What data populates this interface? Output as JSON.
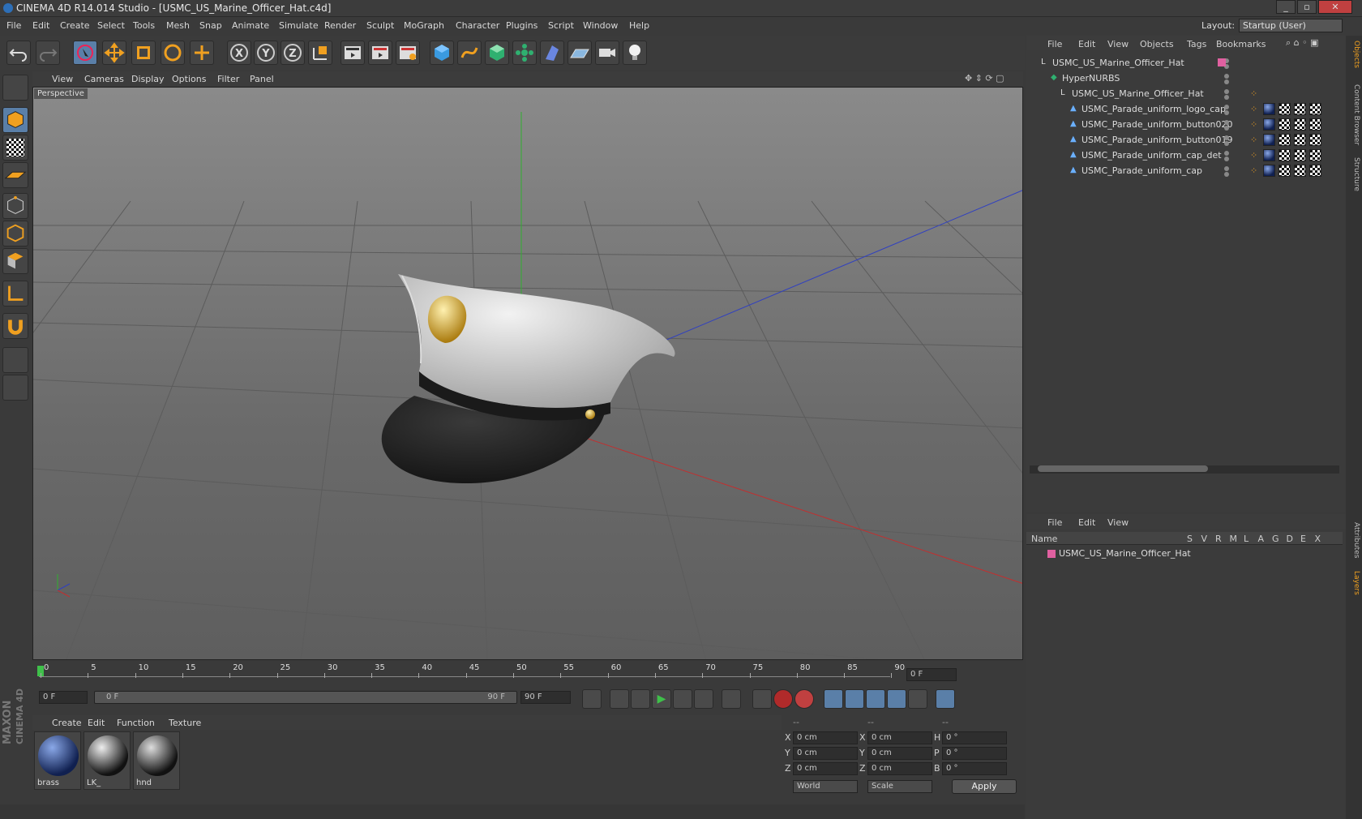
{
  "window": {
    "title": "CINEMA 4D R14.014 Studio - [USMC_US_Marine_Officer_Hat.c4d]",
    "min": "_",
    "max": "▫",
    "close": "✕"
  },
  "menu": [
    "File",
    "Edit",
    "Create",
    "Select",
    "Tools",
    "Mesh",
    "Snap",
    "Animate",
    "Simulate",
    "Render",
    "Sculpt",
    "MoGraph",
    "Character",
    "Plugins",
    "Script",
    "Window",
    "Help"
  ],
  "layout": {
    "label": "Layout:",
    "value": "Startup (User)"
  },
  "toolbar": {
    "x": "X",
    "y": "Y",
    "z": "Z"
  },
  "viewport": {
    "menu": [
      "View",
      "Cameras",
      "Display",
      "Options",
      "Filter",
      "Panel"
    ],
    "label": "Perspective"
  },
  "timeline": {
    "ticks": [
      "0",
      "5",
      "10",
      "15",
      "20",
      "25",
      "30",
      "35",
      "40",
      "45",
      "50",
      "55",
      "60",
      "65",
      "70",
      "75",
      "80",
      "85",
      "90"
    ],
    "frame": "0 F"
  },
  "transport": {
    "start": "0 F",
    "range_left": "0 F",
    "range_right": "90 F",
    "end": "90 F"
  },
  "materials": {
    "menu": [
      "Create",
      "Edit",
      "Function",
      "Texture"
    ],
    "items": [
      {
        "name": "brass"
      },
      {
        "name": "LK_"
      },
      {
        "name": "hnd"
      }
    ]
  },
  "coords": {
    "header": [
      "--",
      "--",
      "--"
    ],
    "rows": [
      {
        "a": "X",
        "av": "0 cm",
        "b": "X",
        "bv": "0 cm",
        "c": "H",
        "cv": "0 °"
      },
      {
        "a": "Y",
        "av": "0 cm",
        "b": "Y",
        "bv": "0 cm",
        "c": "P",
        "cv": "0 °"
      },
      {
        "a": "Z",
        "av": "0 cm",
        "b": "Z",
        "bv": "0 cm",
        "c": "B",
        "cv": "0 °"
      }
    ],
    "world": "World",
    "scale": "Scale",
    "apply": "Apply"
  },
  "objects": {
    "menu": [
      "File",
      "Edit",
      "View",
      "Objects",
      "Tags",
      "Bookmarks"
    ],
    "items": [
      {
        "label": "USMC_US_Marine_Officer_Hat",
        "indent": 0
      },
      {
        "label": "HyperNURBS",
        "indent": 1
      },
      {
        "label": "USMC_US_Marine_Officer_Hat",
        "indent": 2
      },
      {
        "label": "USMC_Parade_uniform_logo_cap",
        "indent": 3
      },
      {
        "label": "USMC_Parade_uniform_button020",
        "indent": 3
      },
      {
        "label": "USMC_Parade_uniform_button019",
        "indent": 3
      },
      {
        "label": "USMC_Parade_uniform_cap_det",
        "indent": 3
      },
      {
        "label": "USMC_Parade_uniform_cap",
        "indent": 3
      }
    ]
  },
  "layers": {
    "menu": [
      "File",
      "Edit",
      "View"
    ],
    "name_header": "Name",
    "cols": [
      "S",
      "V",
      "R",
      "M",
      "L",
      "A",
      "G",
      "D",
      "E",
      "X"
    ],
    "row": "USMC_US_Marine_Officer_Hat"
  },
  "side_tabs": [
    "Objects",
    "Content Browser",
    "Structure",
    "Attributes",
    "Layers"
  ],
  "brand": {
    "line1": "MAXON",
    "line2": "CINEMA 4D"
  },
  "colors": {
    "accent": "#5a7fa8",
    "layer": "#e060a0",
    "grid_x": "#c03030",
    "grid_y": "#30b030",
    "grid_z": "#3040c0"
  }
}
